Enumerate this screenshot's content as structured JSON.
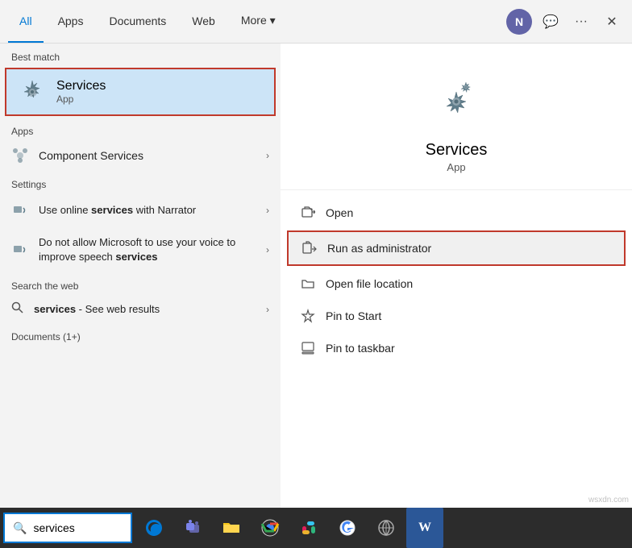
{
  "nav": {
    "tabs": [
      {
        "id": "all",
        "label": "All",
        "active": true
      },
      {
        "id": "apps",
        "label": "Apps"
      },
      {
        "id": "documents",
        "label": "Documents"
      },
      {
        "id": "web",
        "label": "Web"
      },
      {
        "id": "more",
        "label": "More ▾"
      }
    ],
    "avatar_letter": "N",
    "feedback_icon": "💬",
    "more_icon": "···",
    "close_icon": "✕"
  },
  "left_panel": {
    "best_match_label": "Best match",
    "best_match": {
      "title": "Services",
      "subtitle": "App"
    },
    "apps_label": "Apps",
    "apps_items": [
      {
        "label": "Component Services",
        "has_chevron": true
      }
    ],
    "settings_label": "Settings",
    "settings_items": [
      {
        "label_html": "Use online <b>services</b> with Narrator",
        "has_chevron": true
      },
      {
        "label_html": "Do not allow Microsoft to use your voice to improve speech <b>services</b>",
        "has_chevron": true
      }
    ],
    "search_web_label": "Search the web",
    "search_web_items": [
      {
        "label": "services",
        "suffix": " - See web results",
        "has_chevron": true
      }
    ],
    "docs_label": "Documents (1+)"
  },
  "right_panel": {
    "app_title": "Services",
    "app_subtitle": "App",
    "actions": [
      {
        "id": "open",
        "label": "Open",
        "highlighted": false
      },
      {
        "id": "run-as-admin",
        "label": "Run as administrator",
        "highlighted": true
      },
      {
        "id": "open-file-location",
        "label": "Open file location",
        "highlighted": false
      },
      {
        "id": "pin-to-start",
        "label": "Pin to Start",
        "highlighted": false
      },
      {
        "id": "pin-to-taskbar",
        "label": "Pin to taskbar",
        "highlighted": false
      }
    ]
  },
  "taskbar": {
    "search_placeholder": "services",
    "search_value": "services",
    "icons": [
      {
        "name": "edge",
        "symbol": "🌐"
      },
      {
        "name": "teams",
        "symbol": "👥"
      },
      {
        "name": "files",
        "symbol": "📁"
      },
      {
        "name": "chrome",
        "symbol": "🔵"
      },
      {
        "name": "slack",
        "symbol": "🟫"
      },
      {
        "name": "google",
        "symbol": "🔍"
      },
      {
        "name": "network",
        "symbol": "📡"
      },
      {
        "name": "word",
        "symbol": "W"
      }
    ]
  }
}
